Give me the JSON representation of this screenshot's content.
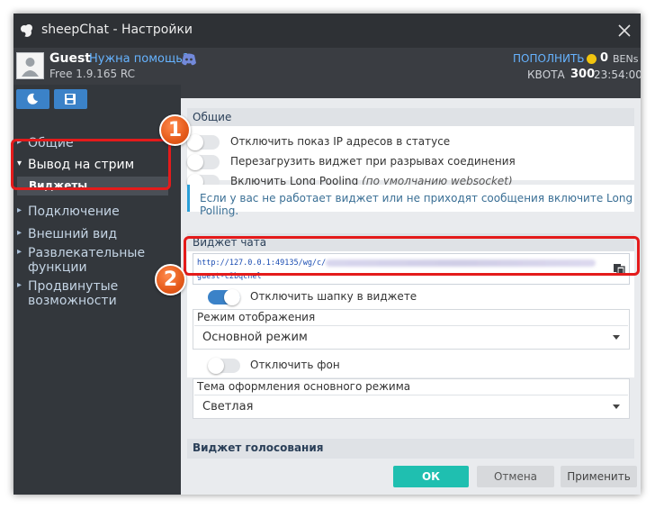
{
  "window": {
    "title": "sheepChat - Настройки"
  },
  "user": {
    "name": "Guest",
    "help_link": "Нужна помощь?",
    "version": "Free 1.9.165 RC",
    "topup": "ПОПОЛНИТЬ",
    "bens_value": "0",
    "bens_currency": "BENs",
    "quota_label": "КВОТА",
    "quota_value": "300",
    "time": "23:54:00"
  },
  "sidebar": {
    "items": [
      {
        "label": "Общие",
        "caret": "▸"
      },
      {
        "label": "Вывод на стрим",
        "caret": "▾"
      },
      {
        "label": "Подключение",
        "caret": "▸"
      },
      {
        "label": "Внешний вид",
        "caret": "▸"
      },
      {
        "label": "Развлекательные функции",
        "caret": "▸"
      },
      {
        "label": "Продвинутые возможности",
        "caret": "▸"
      }
    ],
    "subitem": "Виджеты"
  },
  "general": {
    "title": "Общие",
    "options": [
      {
        "label": "Отключить показ IP адресов в статусе",
        "on": false
      },
      {
        "label": "Перезагрузить виджет при разрывах соединения",
        "on": false
      },
      {
        "label": "Включить Long Pooling",
        "note": "(по умолчанию websocket)",
        "on": false
      }
    ],
    "info": "Если у вас не работает виджет или не приходят сообщения включите Long Polling."
  },
  "chat_widget": {
    "title": "Виджет чата",
    "url_line1": "http://127.0.0.1:49135/wg/c/",
    "url_line2": "guest-c2bqcnel",
    "toggle_header": {
      "label": "Отключить шапку в виджете",
      "on": true
    },
    "display_mode": {
      "label": "Режим отображения",
      "value": "Основной режим"
    },
    "toggle_bg": {
      "label": "Отключить фон",
      "on": false
    },
    "theme": {
      "label": "Тема оформления основного режима",
      "value": "Светлая"
    }
  },
  "vote_widget": {
    "title": "Виджет голосования"
  },
  "footer": {
    "ok": "ОК",
    "cancel": "Отмена",
    "apply": "Применить"
  },
  "annotations": {
    "badge1": "1",
    "badge2": "2"
  },
  "colors": {
    "accent": "#3b82c8",
    "ok": "#1fbfb0",
    "highlight": "#e41b1b",
    "badge": "#e55a1a"
  },
  "icons": [
    "sheep-logo-icon",
    "close-icon",
    "discord-icon",
    "coin-icon",
    "moon-icon",
    "save-icon",
    "copy-icon",
    "chevron-down-icon"
  ]
}
